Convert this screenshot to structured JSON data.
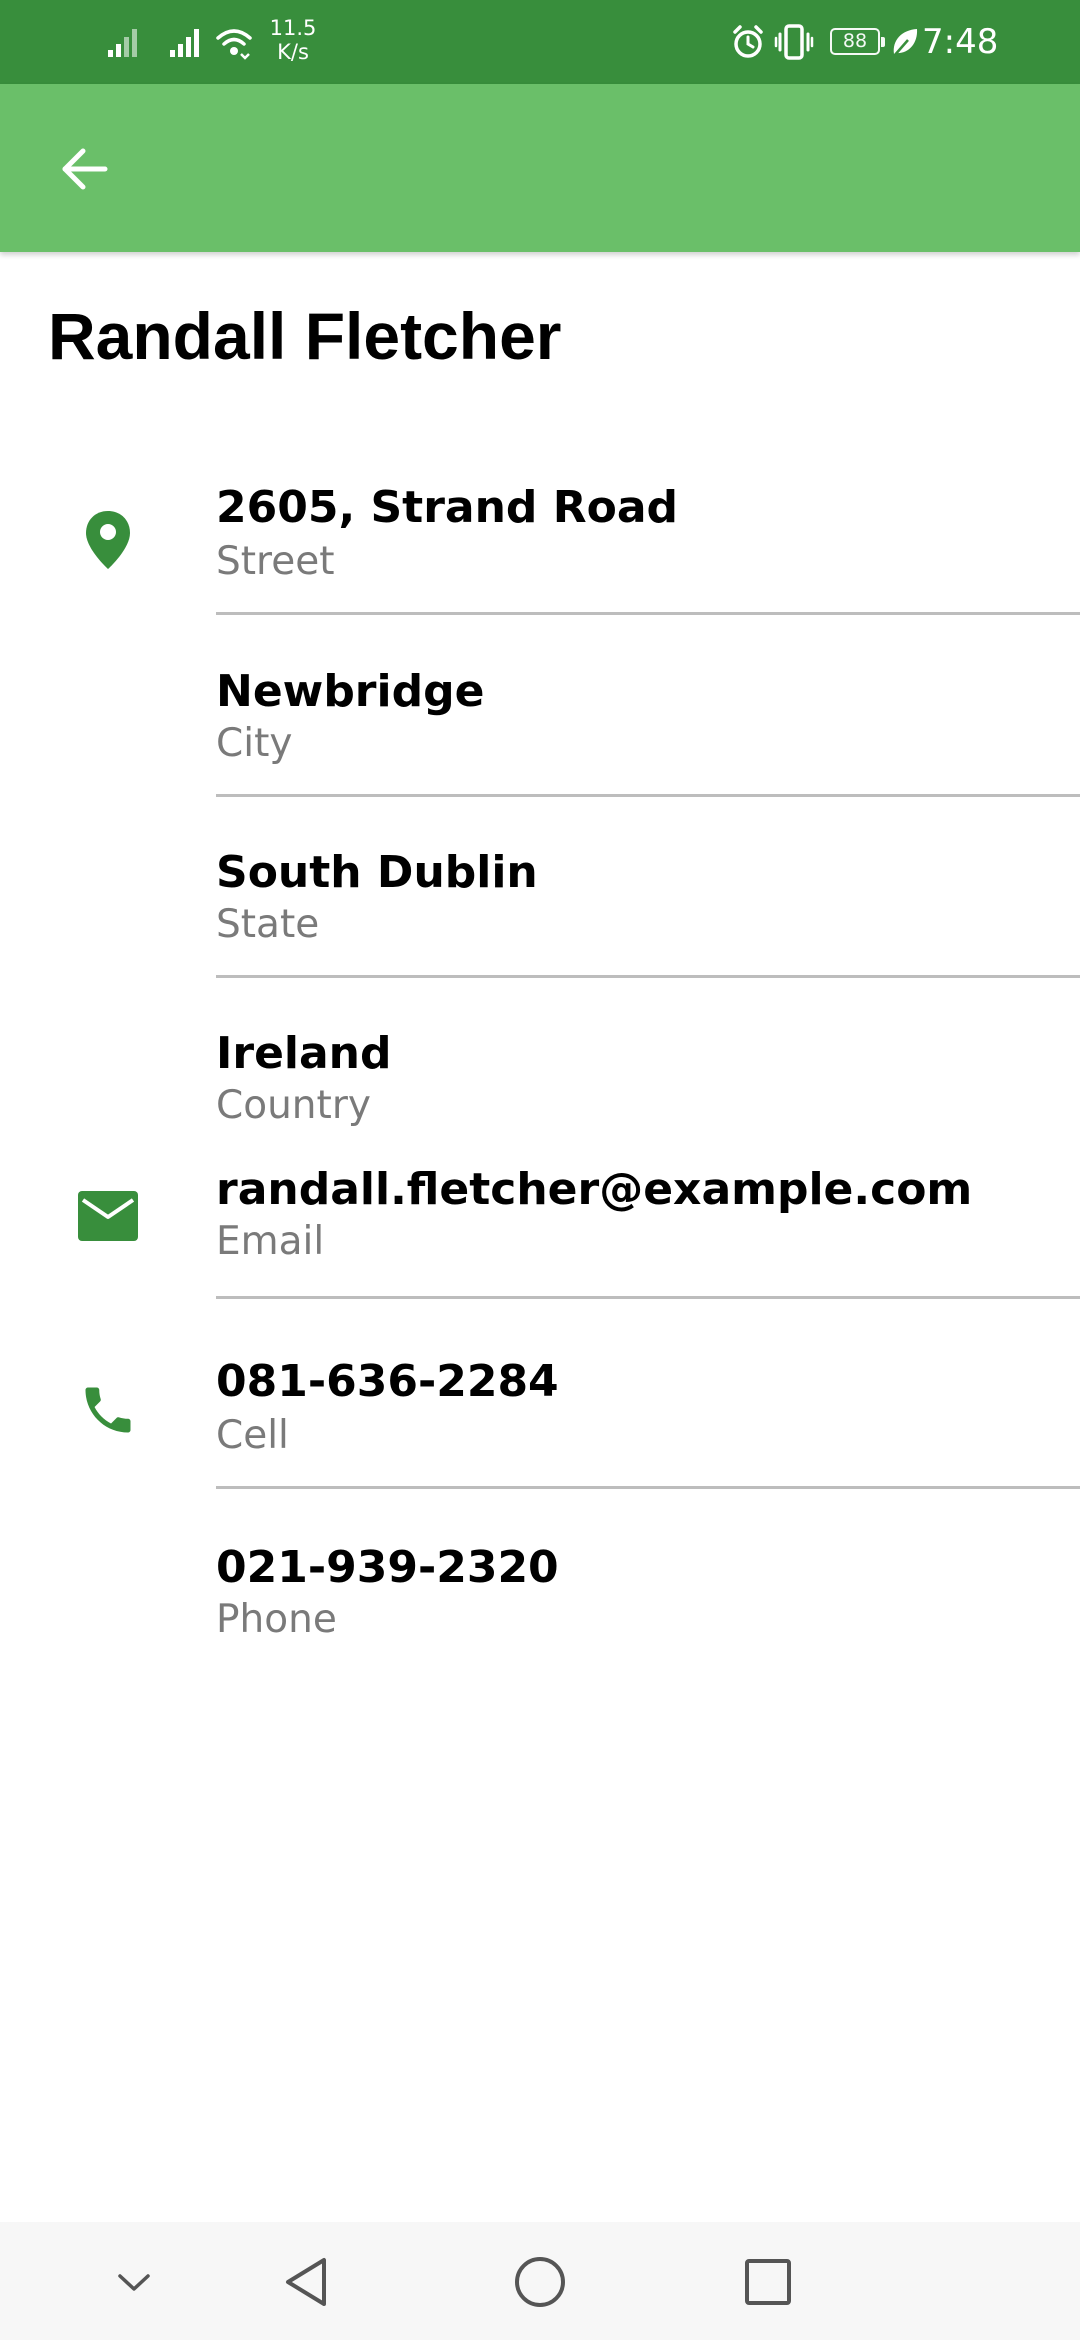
{
  "status_bar": {
    "net_speed_value": "11.5",
    "net_speed_unit": "K/s",
    "battery_level": "88",
    "time": "7:48",
    "icons": [
      "signal-icon",
      "signal-icon",
      "wifi-icon",
      "alarm-icon",
      "vibrate-icon",
      "battery-icon",
      "leaf-icon"
    ]
  },
  "app_bar": {
    "back_icon": "arrow-left-icon"
  },
  "contact": {
    "name": "Randall Fletcher",
    "street": {
      "value": "2605, Strand Road",
      "label": "Street"
    },
    "city": {
      "value": "Newbridge",
      "label": "City"
    },
    "state": {
      "value": "South Dublin",
      "label": "State"
    },
    "country": {
      "value": "Ireland",
      "label": "Country"
    },
    "email": {
      "value": "randall.fletcher@example.com",
      "label": "Email"
    },
    "cell": {
      "value": "081-636-2284",
      "label": "Cell"
    },
    "phone": {
      "value": "021-939-2320",
      "label": "Phone"
    }
  },
  "colors": {
    "status_bar": "#388e3c",
    "app_bar": "#6abf69",
    "icon_accent": "#388e3c",
    "label_text": "#7a7a7a",
    "divider": "#bdbdbd"
  },
  "nav_bar": {
    "icons": [
      "chevron-down-icon",
      "back-triangle-icon",
      "home-circle-icon",
      "recents-square-icon"
    ]
  }
}
